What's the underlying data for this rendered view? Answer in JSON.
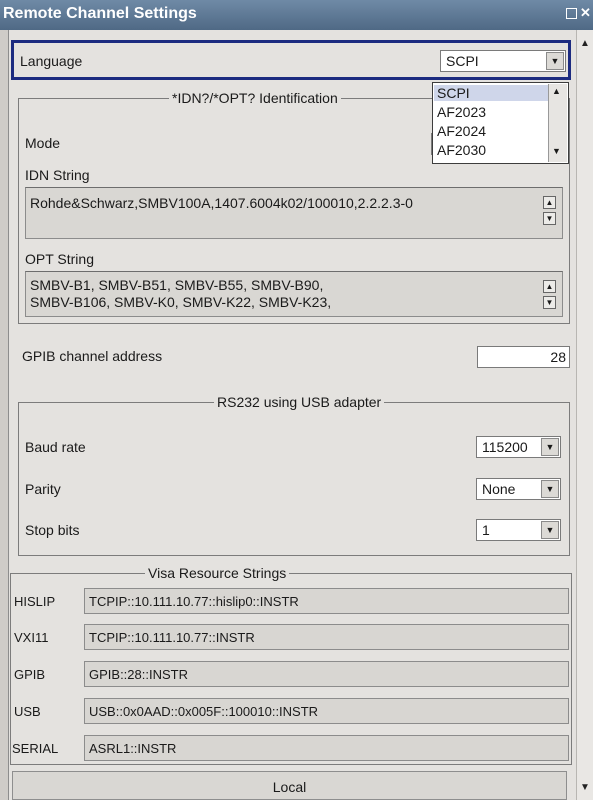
{
  "window": {
    "title": "Remote Channel Settings"
  },
  "language": {
    "label": "Language",
    "value": "SCPI",
    "options": [
      "SCPI",
      "AF2023",
      "AF2024",
      "AF2030"
    ]
  },
  "identification": {
    "group_title": "*IDN?/*OPT? Identification",
    "mode_label": "Mode",
    "idn_label": "IDN String",
    "idn_value": "Rohde&Schwarz,SMBV100A,1407.6004k02/100010,2.2.2.3-0",
    "opt_label": "OPT String",
    "opt_line1": "SMBV-B1, SMBV-B51, SMBV-B55, SMBV-B90,",
    "opt_line2": "SMBV-B106, SMBV-K0, SMBV-K22, SMBV-K23,"
  },
  "gpib": {
    "label": "GPIB channel address",
    "value": "28"
  },
  "rs232": {
    "group_title": "RS232 using USB adapter",
    "baud_label": "Baud rate",
    "baud_value": "115200",
    "parity_label": "Parity",
    "parity_value": "None",
    "stop_label": "Stop bits",
    "stop_value": "1"
  },
  "visa": {
    "group_title": "Visa Resource Strings",
    "rows": [
      {
        "label": "HISLIP",
        "value": "TCPIP::10.111.10.77::hislip0::INSTR"
      },
      {
        "label": "VXI11",
        "value": "TCPIP::10.111.10.77::INSTR"
      },
      {
        "label": "GPIB",
        "value": "GPIB::28::INSTR"
      },
      {
        "label": "USB",
        "value": "USB::0x0AAD::0x005F::100010::INSTR"
      },
      {
        "label": "SERIAL",
        "value": "ASRL1::INSTR"
      }
    ]
  },
  "local_button": "Local",
  "colors": {
    "title_bar": "#5a7592",
    "focus_border": "#1c2b80",
    "dropdown_selected": "#cfd6ea"
  }
}
